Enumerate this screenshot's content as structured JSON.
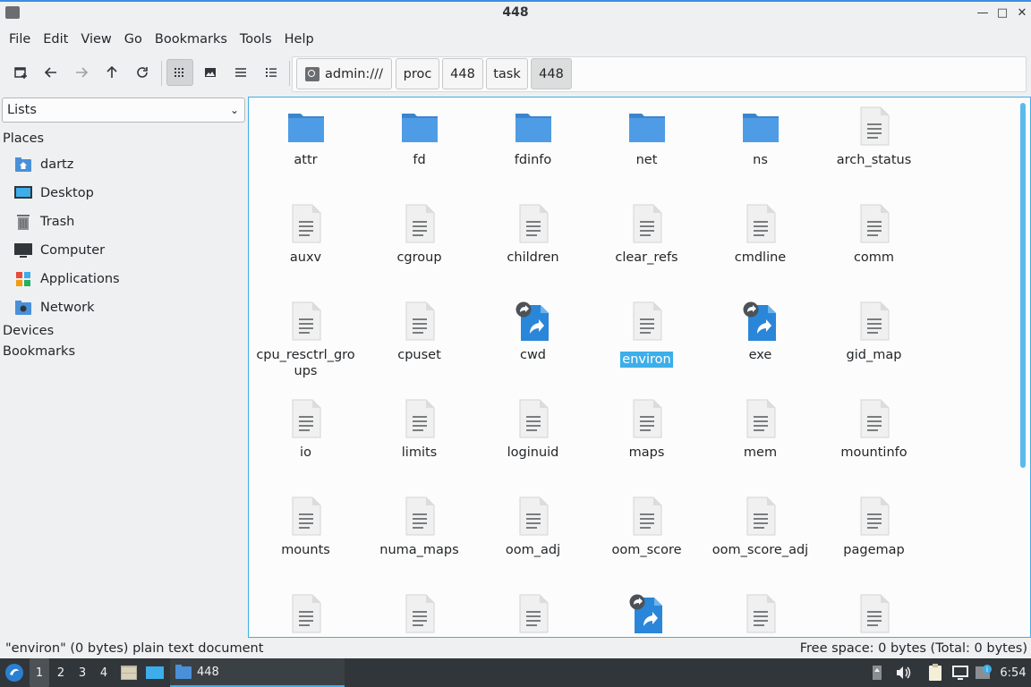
{
  "window": {
    "title": "448"
  },
  "menu": [
    "File",
    "Edit",
    "View",
    "Go",
    "Bookmarks",
    "Tools",
    "Help"
  ],
  "breadcrumbs": [
    "admin:///",
    "proc",
    "448",
    "task",
    "448"
  ],
  "sidepane": {
    "mode": "Lists",
    "places_header": "Places",
    "places": [
      "dartz",
      "Desktop",
      "Trash",
      "Computer",
      "Applications",
      "Network"
    ],
    "devices_header": "Devices",
    "bookmarks_header": "Bookmarks"
  },
  "files": [
    {
      "name": "attr",
      "type": "folder"
    },
    {
      "name": "fd",
      "type": "folder"
    },
    {
      "name": "fdinfo",
      "type": "folder"
    },
    {
      "name": "net",
      "type": "folder"
    },
    {
      "name": "ns",
      "type": "folder"
    },
    {
      "name": "arch_status",
      "type": "file"
    },
    {
      "name": "auxv",
      "type": "file"
    },
    {
      "name": "cgroup",
      "type": "file"
    },
    {
      "name": "children",
      "type": "file"
    },
    {
      "name": "clear_refs",
      "type": "file"
    },
    {
      "name": "cmdline",
      "type": "file"
    },
    {
      "name": "comm",
      "type": "file"
    },
    {
      "name": "cpu_resctrl_groups",
      "type": "file"
    },
    {
      "name": "cpuset",
      "type": "file"
    },
    {
      "name": "cwd",
      "type": "link"
    },
    {
      "name": "environ",
      "type": "file",
      "selected": true
    },
    {
      "name": "exe",
      "type": "link"
    },
    {
      "name": "gid_map",
      "type": "file"
    },
    {
      "name": "io",
      "type": "file"
    },
    {
      "name": "limits",
      "type": "file"
    },
    {
      "name": "loginuid",
      "type": "file"
    },
    {
      "name": "maps",
      "type": "file"
    },
    {
      "name": "mem",
      "type": "file"
    },
    {
      "name": "mountinfo",
      "type": "file"
    },
    {
      "name": "mounts",
      "type": "file"
    },
    {
      "name": "numa_maps",
      "type": "file"
    },
    {
      "name": "oom_adj",
      "type": "file"
    },
    {
      "name": "oom_score",
      "type": "file"
    },
    {
      "name": "oom_score_adj",
      "type": "file"
    },
    {
      "name": "pagemap",
      "type": "file"
    },
    {
      "name": "",
      "type": "file"
    },
    {
      "name": "",
      "type": "file"
    },
    {
      "name": "",
      "type": "file"
    },
    {
      "name": "",
      "type": "link"
    },
    {
      "name": "",
      "type": "file"
    },
    {
      "name": "",
      "type": "file"
    }
  ],
  "status": {
    "left": "\"environ\" (0 bytes) plain text document",
    "right": "Free space: 0 bytes (Total: 0 bytes)"
  },
  "taskbar": {
    "workspaces": [
      "1",
      "2",
      "3",
      "4"
    ],
    "task_label": "448",
    "clock": "6:54"
  },
  "colors": {
    "accent": "#3daee9",
    "folder": "#4a90d9",
    "taskbar": "#31363b"
  }
}
